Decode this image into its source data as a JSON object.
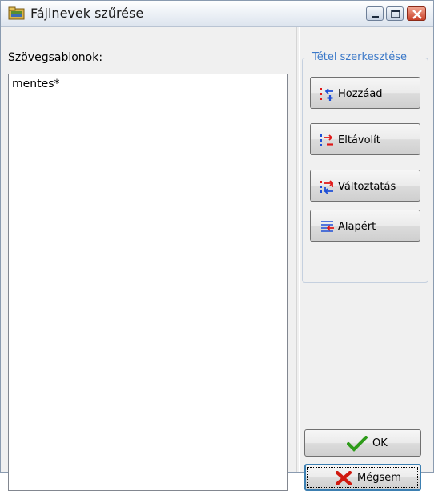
{
  "window": {
    "title": "Fájlnevek szűrése",
    "controls": [
      "minimize",
      "maximize",
      "close"
    ]
  },
  "patterns": {
    "label": "Szövegsablonok:",
    "items": [
      "mentes*"
    ]
  },
  "edit_group": {
    "title": "Tétel szerkesztése",
    "buttons": {
      "add": "Hozzáad",
      "remove": "Eltávolít",
      "change": "Változtatás",
      "default": "Alapért"
    }
  },
  "dialog_buttons": {
    "ok": "OK",
    "cancel": "Mégsem"
  },
  "colors": {
    "group_title": "#3a78c8",
    "ok_check": "#2e9b1a",
    "cancel_x": "#d01a10",
    "icon_blue": "#1f4fd6",
    "icon_red": "#e01818"
  }
}
